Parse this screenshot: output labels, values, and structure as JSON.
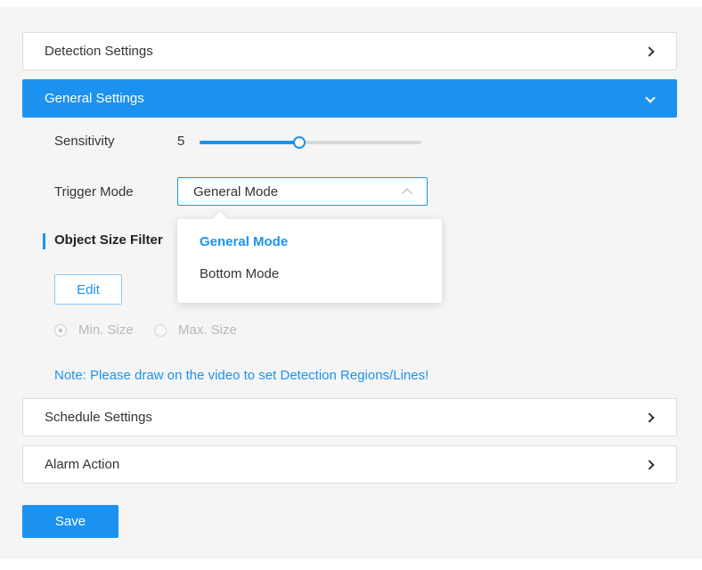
{
  "panels": {
    "detection_settings": "Detection Settings",
    "general_settings": "General Settings",
    "schedule_settings": "Schedule Settings",
    "alarm_action": "Alarm Action"
  },
  "sensitivity": {
    "label": "Sensitivity",
    "value": "5",
    "fraction": 0.45
  },
  "trigger_mode": {
    "label": "Trigger Mode",
    "selected": "General Mode",
    "options": [
      "General Mode",
      "Bottom Mode"
    ]
  },
  "object_size_filter": {
    "title": "Object Size Filter",
    "edit_label": "Edit",
    "min_size_label": "Min. Size",
    "max_size_label": "Max. Size"
  },
  "note": "Note: Please draw on the video to set Detection Regions/Lines!",
  "save_label": "Save",
  "colors": {
    "accent": "#1c92f0",
    "background": "#f5f5f5"
  }
}
